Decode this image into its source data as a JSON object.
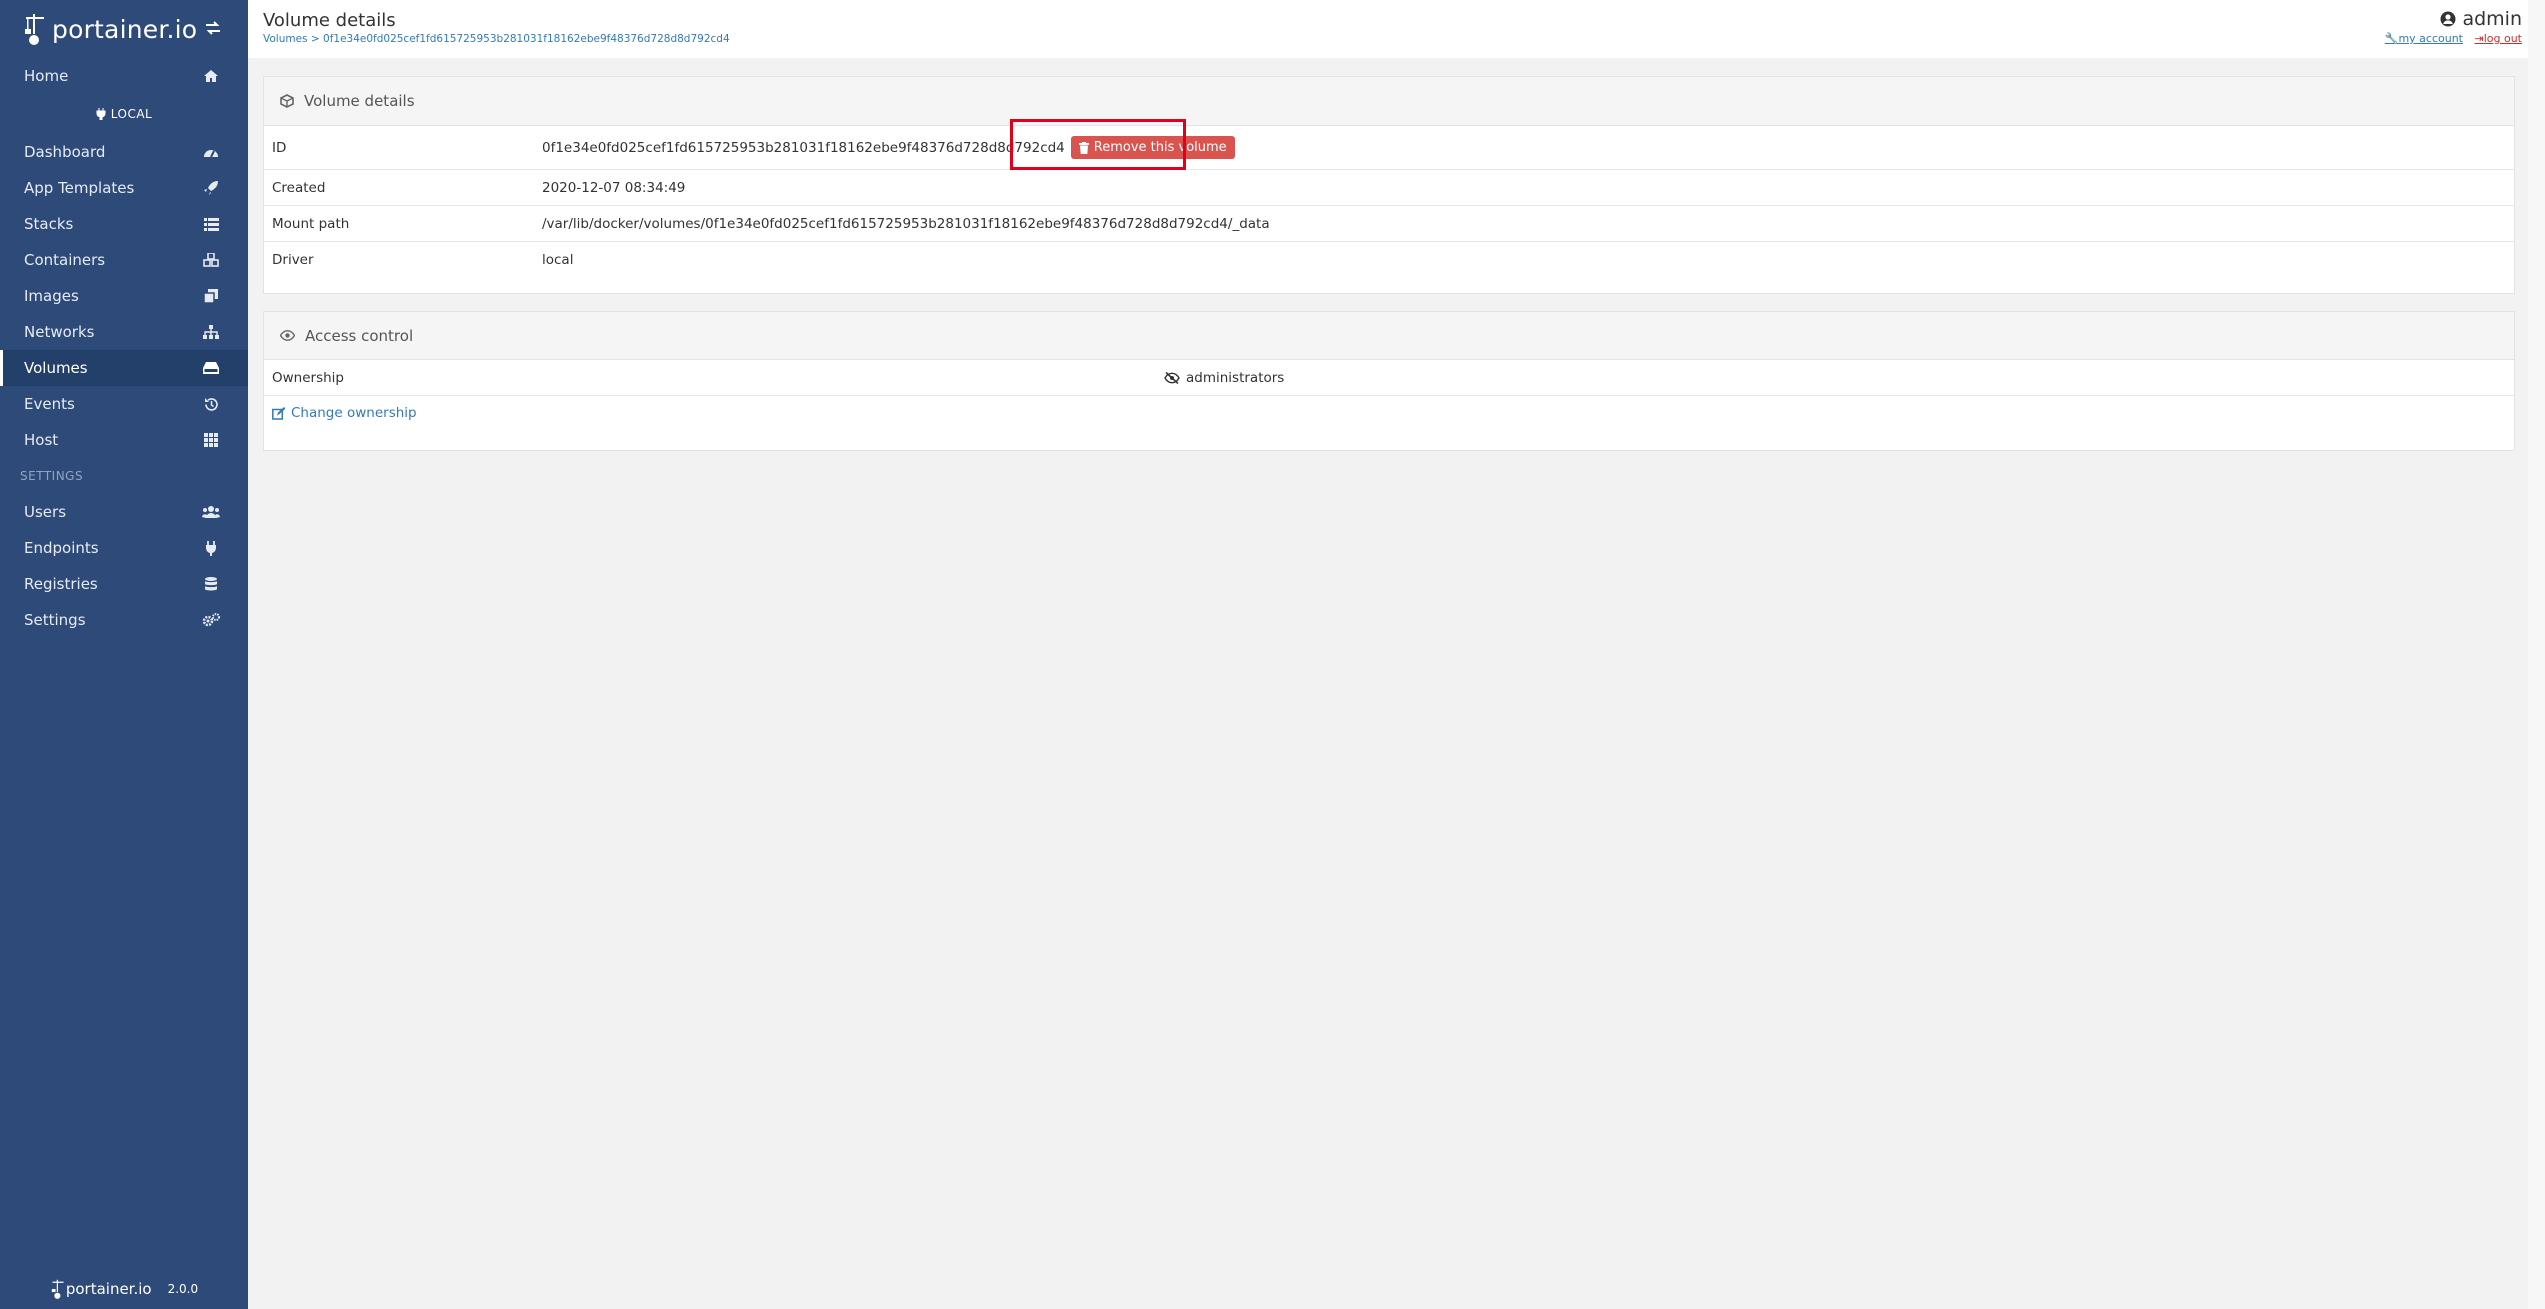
{
  "brand": {
    "name": "portainer.io",
    "toggle_icon": "swap-arrows-icon"
  },
  "sidebar": {
    "home": {
      "label": "Home",
      "icon": "home-icon"
    },
    "endpoint": "LOCAL",
    "items": [
      {
        "label": "Dashboard",
        "icon": "tachometer-icon"
      },
      {
        "label": "App Templates",
        "icon": "rocket-icon"
      },
      {
        "label": "Stacks",
        "icon": "list-icon"
      },
      {
        "label": "Containers",
        "icon": "cubes-icon"
      },
      {
        "label": "Images",
        "icon": "clone-icon"
      },
      {
        "label": "Networks",
        "icon": "sitemap-icon"
      },
      {
        "label": "Volumes",
        "icon": "hdd-icon",
        "active": true
      },
      {
        "label": "Events",
        "icon": "history-icon"
      },
      {
        "label": "Host",
        "icon": "th-icon"
      }
    ],
    "settings_section": "SETTINGS",
    "settings_items": [
      {
        "label": "Users",
        "icon": "users-icon"
      },
      {
        "label": "Endpoints",
        "icon": "plug-icon"
      },
      {
        "label": "Registries",
        "icon": "database-icon"
      },
      {
        "label": "Settings",
        "icon": "cogs-icon"
      }
    ],
    "footer": {
      "brand": "portainer.io",
      "version": "2.0.0"
    }
  },
  "header": {
    "title": "Volume details",
    "breadcrumb_root": "Volumes",
    "breadcrumb_sep": " > ",
    "breadcrumb_current": "0f1e34e0fd025cef1fd615725953b281031f18162ebe9f48376d728d8d792cd4",
    "user": "admin",
    "my_account": "my account",
    "log_out": "log out"
  },
  "volume_panel": {
    "title": "Volume details",
    "id_label": "ID",
    "id_value": "0f1e34e0fd025cef1fd615725953b281031f18162ebe9f48376d728d8d792cd4",
    "remove_button": "Remove this volume",
    "created_label": "Created",
    "created_value": "2020-12-07 08:34:49",
    "mount_label": "Mount path",
    "mount_value": "/var/lib/docker/volumes/0f1e34e0fd025cef1fd615725953b281031f18162ebe9f48376d728d8d792cd4/_data",
    "driver_label": "Driver",
    "driver_value": "local"
  },
  "access_panel": {
    "title": "Access control",
    "ownership_label": "Ownership",
    "ownership_value": "administrators",
    "change_link": "Change ownership"
  },
  "colors": {
    "sidebar": "#2e4a78",
    "danger": "#d9534f",
    "link": "#337ab7",
    "highlight": "#e0001a"
  }
}
